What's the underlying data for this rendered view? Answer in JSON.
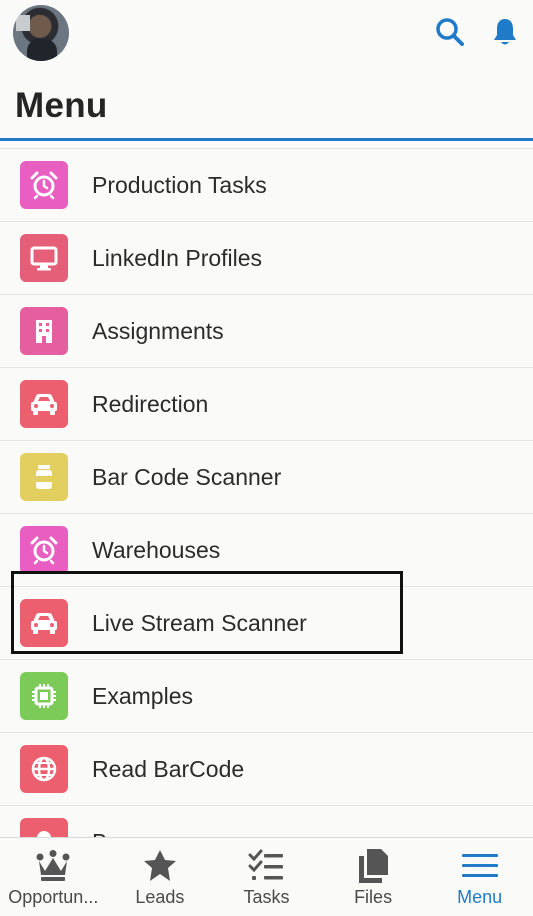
{
  "header": {
    "title": "Menu"
  },
  "menu_items": [
    {
      "label": "Production Tasks",
      "color": "#e85fc1",
      "icon": "alarm-clock-icon"
    },
    {
      "label": "LinkedIn Profiles",
      "color": "#e45f77",
      "icon": "monitor-icon"
    },
    {
      "label": "Assignments",
      "color": "#e55e9f",
      "icon": "building-icon"
    },
    {
      "label": "Redirection",
      "color": "#ec5f6e",
      "icon": "car-icon"
    },
    {
      "label": "Bar Code Scanner",
      "color": "#e3cf5f",
      "icon": "jar-icon"
    },
    {
      "label": "Warehouses",
      "color": "#e85fc1",
      "icon": "alarm-clock-icon"
    },
    {
      "label": "Live Stream Scanner",
      "color": "#ec5f6e",
      "icon": "car-icon"
    },
    {
      "label": "Examples",
      "color": "#7ccb59",
      "icon": "chip-icon"
    },
    {
      "label": "Read BarCode",
      "color": "#ec5f6e",
      "icon": "globe-icon"
    },
    {
      "label": "Bs",
      "color": "#ec5f6e",
      "icon": "person-icon"
    }
  ],
  "tabs": [
    {
      "label": "Opportun...",
      "icon": "crown-icon"
    },
    {
      "label": "Leads",
      "icon": "star-person-icon"
    },
    {
      "label": "Tasks",
      "icon": "checklist-icon"
    },
    {
      "label": "Files",
      "icon": "files-icon"
    },
    {
      "label": "Menu",
      "icon": "hamburger-icon"
    }
  ],
  "colors": {
    "accent": "#1f7bc8"
  }
}
